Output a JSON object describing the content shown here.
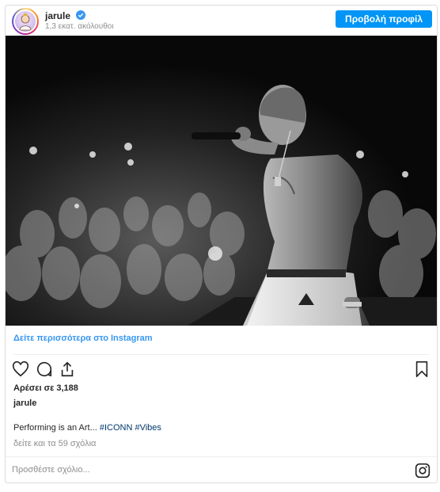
{
  "header": {
    "username": "jarule",
    "followers": "1,3 εκατ. ακόλουθοι",
    "view_profile_button": "Προβολή προφίλ"
  },
  "post": {
    "see_more_link": "Δείτε περισσότερα στο Instagram",
    "likes": "Αρέσει σε 3,188",
    "owner": "jarule",
    "caption_text": "Performing is an Art... ",
    "caption_tags": "#ICONN #Vibes",
    "view_comments": "δείτε και τα 59 σχόλια",
    "comment_placeholder": "Προσθέστε σχόλιο..."
  },
  "icons": [
    "verified-badge-icon",
    "heart-icon",
    "comment-icon",
    "share-icon",
    "bookmark-icon",
    "instagram-icon"
  ],
  "colors": {
    "accent": "#0095f6",
    "link": "#3897f0",
    "text": "#262626",
    "muted": "#8e8e8e"
  }
}
